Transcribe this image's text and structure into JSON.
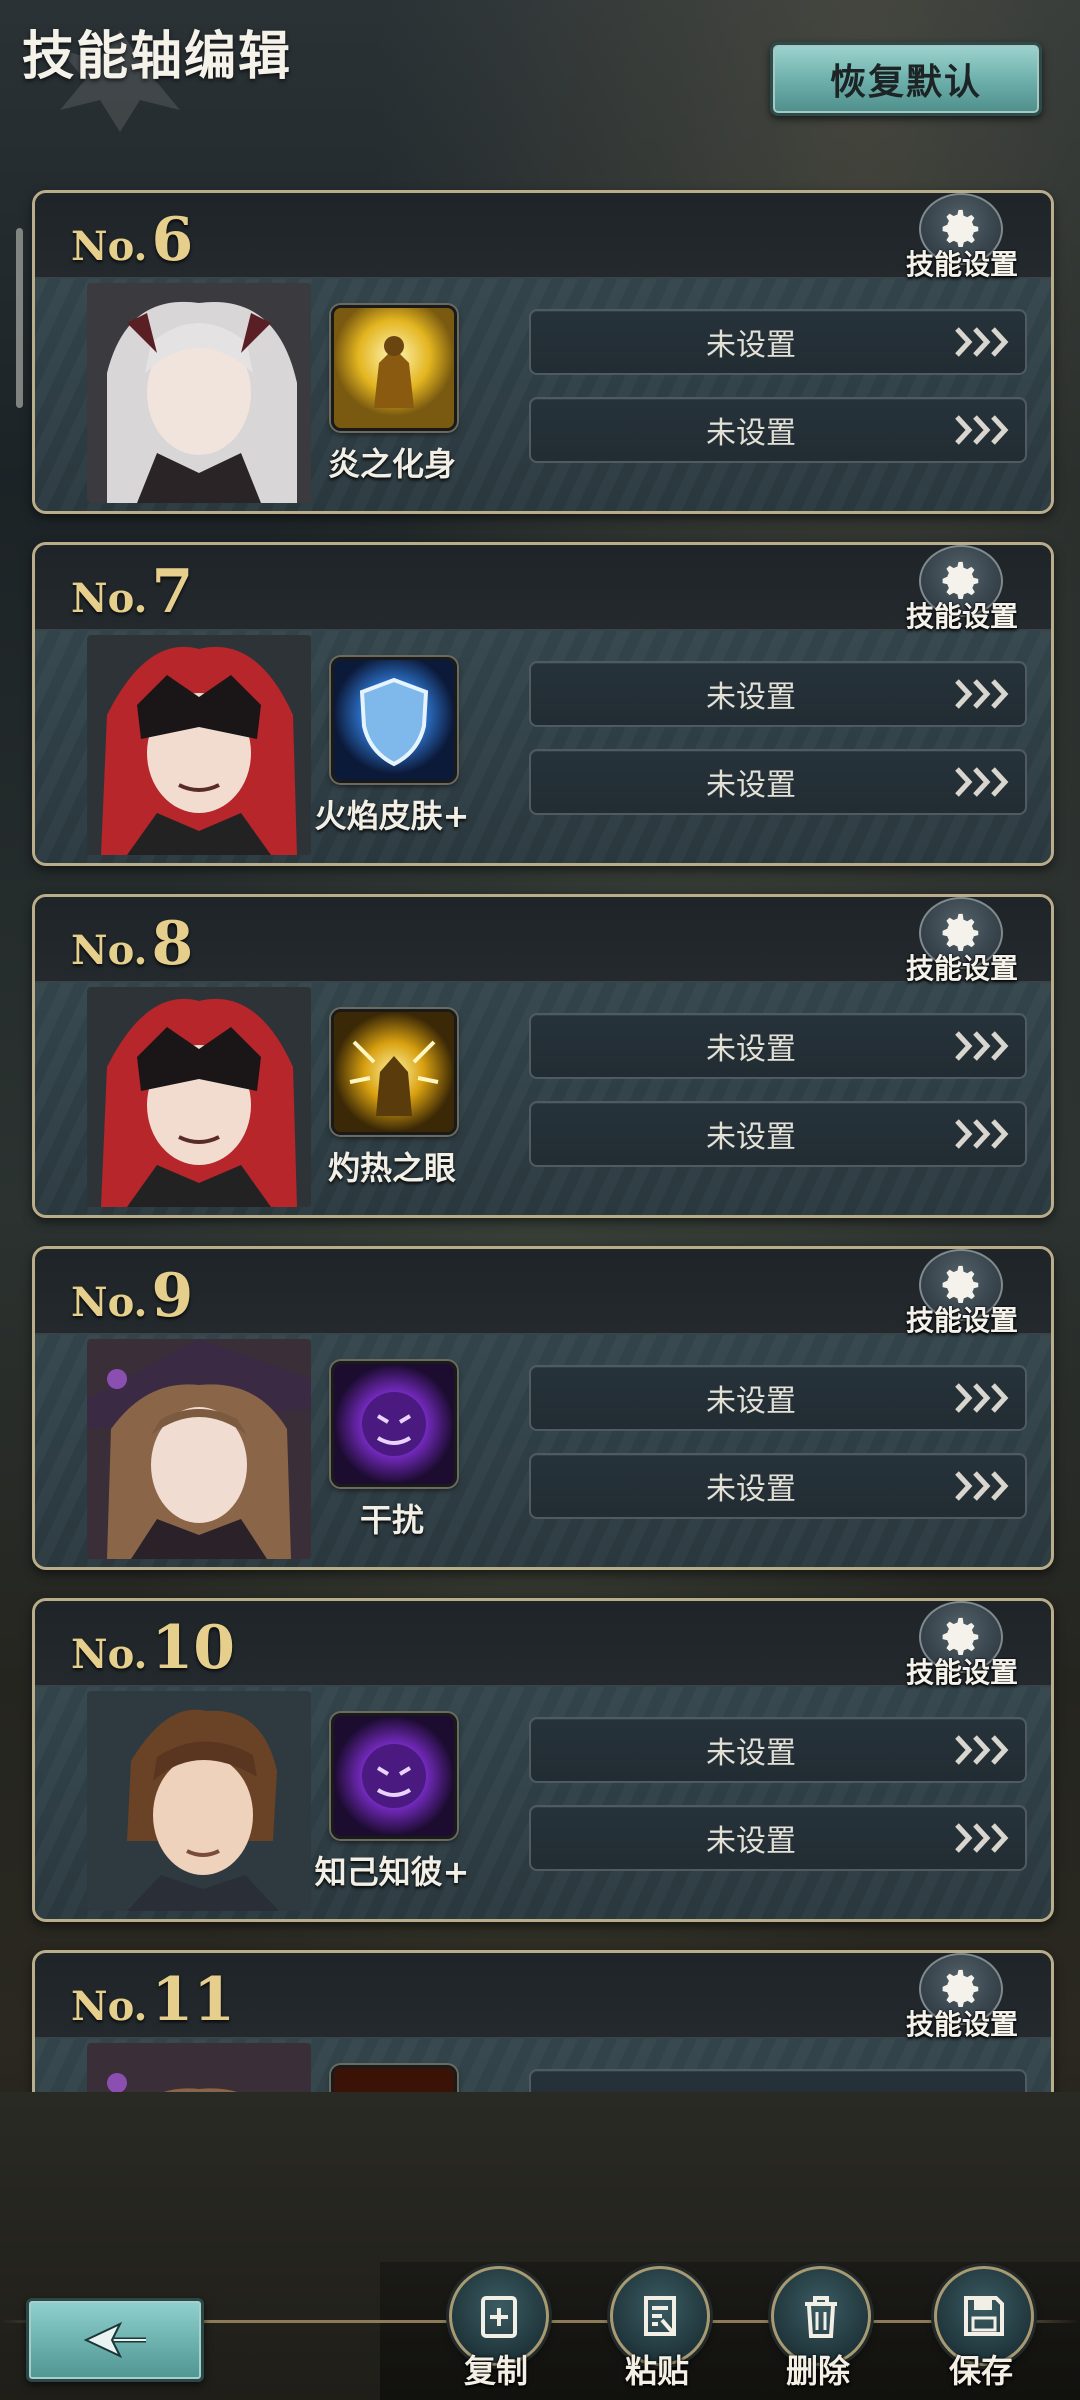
{
  "header": {
    "title": "技能轴编辑",
    "reset_label": "恢复默认"
  },
  "cards": [
    {
      "prefix": "No.",
      "number": "6",
      "settings_label": "技能设置",
      "skill_name": "炎之化身",
      "slot1": "未设置",
      "slot2": "未设置"
    },
    {
      "prefix": "No.",
      "number": "7",
      "settings_label": "技能设置",
      "skill_name": "火焰皮肤+",
      "slot1": "未设置",
      "slot2": "未设置"
    },
    {
      "prefix": "No.",
      "number": "8",
      "settings_label": "技能设置",
      "skill_name": "灼热之眼",
      "slot1": "未设置",
      "slot2": "未设置"
    },
    {
      "prefix": "No.",
      "number": "9",
      "settings_label": "技能设置",
      "skill_name": "干扰",
      "slot1": "未设置",
      "slot2": "未设置"
    },
    {
      "prefix": "No.",
      "number": "10",
      "settings_label": "技能设置",
      "skill_name": "知己知彼+",
      "slot1": "未设置",
      "slot2": "未设置"
    },
    {
      "prefix": "No.",
      "number": "11",
      "settings_label": "技能设置",
      "skill_name": "",
      "slot1": "",
      "slot2": ""
    }
  ],
  "actions": {
    "copy": "复制",
    "paste": "粘贴",
    "delete": "删除",
    "save": "保存"
  },
  "icons": {
    "gear": "gear-icon",
    "arrows": "triple-chevron-icon",
    "back": "back-arrow-icon",
    "copy": "copy-icon",
    "paste": "paste-icon",
    "delete": "trash-icon",
    "save": "floppy-disk-icon"
  },
  "colors": {
    "accent_teal": "#6fb1ad",
    "number_gold": "#e6cf8d",
    "card_border": "#b9ad8a"
  }
}
